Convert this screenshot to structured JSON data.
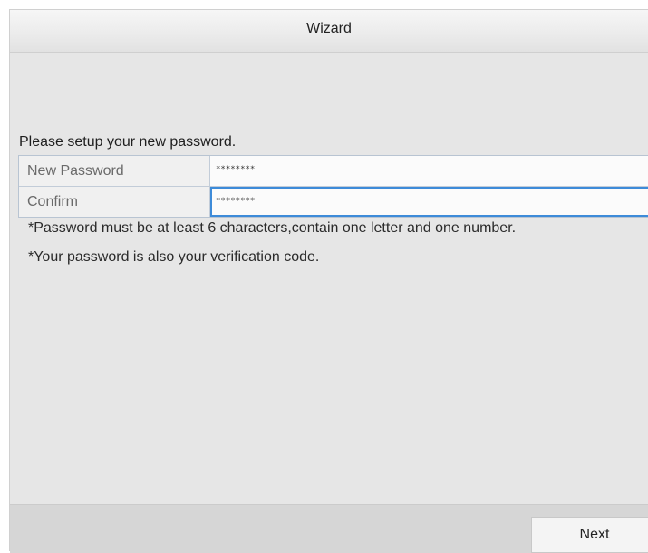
{
  "window": {
    "title": "Wizard"
  },
  "form": {
    "prompt": "Please setup your new password.",
    "new_password": {
      "label": "New Password",
      "value": "********"
    },
    "confirm": {
      "label": "Confirm",
      "value": "********"
    }
  },
  "hints": [
    "*Password must be at least 6 characters,contain one letter and one number.",
    "*Your password is also your verification code."
  ],
  "footer": {
    "next_label": "Next"
  },
  "colors": {
    "focus_border": "#3d8bd9",
    "panel_background": "#e6e6e6"
  }
}
